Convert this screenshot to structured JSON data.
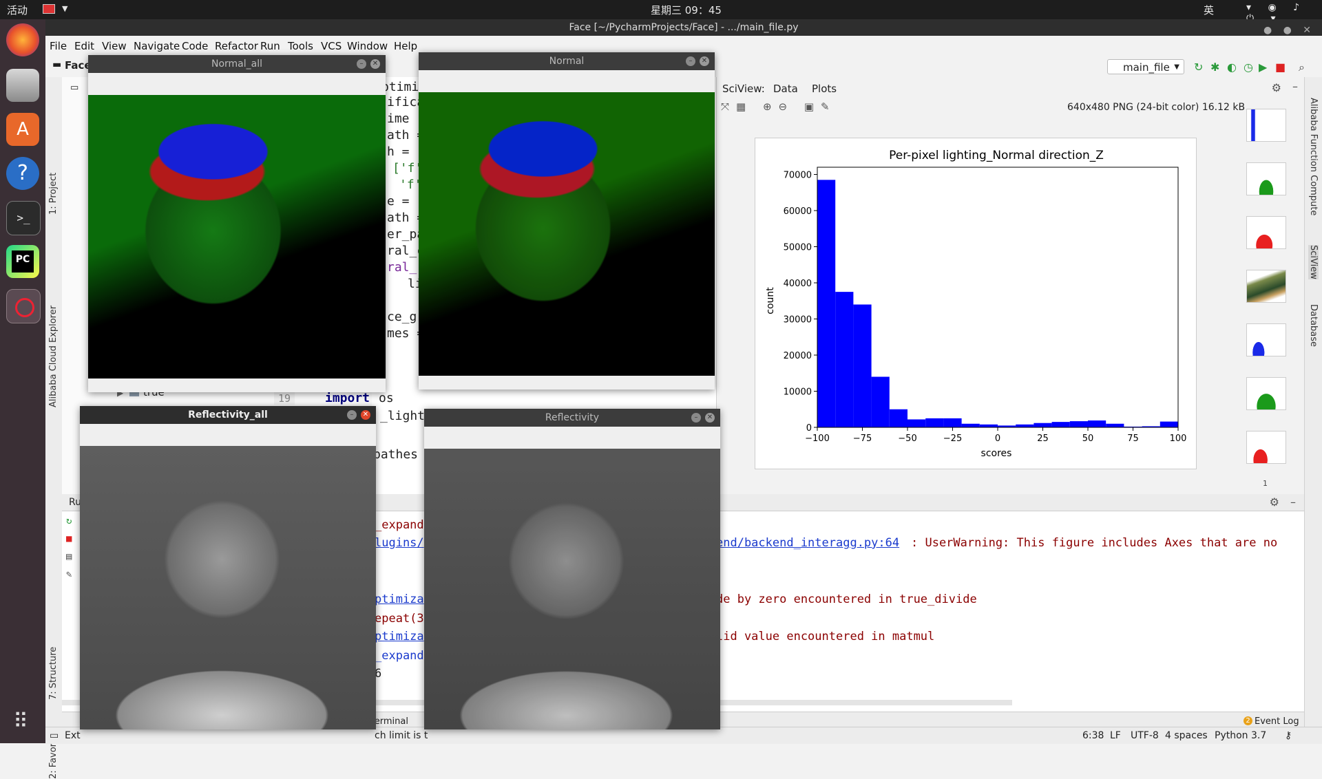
{
  "topbar": {
    "activities": "活动",
    "clock": "星期三 09：45",
    "ime": "英"
  },
  "window": {
    "title": "Face [~/PycharmProjects/Face] - .../main_file.py"
  },
  "menu": [
    "File",
    "Edit",
    "View",
    "Navigate",
    "Code",
    "Refactor",
    "Run",
    "Tools",
    "VCS",
    "Window",
    "Help"
  ],
  "toolbar": {
    "project_name": "Face",
    "run_config": "main_file"
  },
  "side_tools": {
    "project": "1: Project",
    "alibaba_cloud": "Alibaba Cloud Explorer",
    "structure": "7: Structure",
    "favorites": "2: Favorites",
    "alibaba_fc": "Alibaba Function Compute",
    "sciview": "SciView",
    "database": "Database"
  },
  "editor": {
    "lines": [
      "ptimiza",
      "ifica",
      "ime",
      "ath =",
      "h =",
      "['f'",
      "'f'",
      "e =",
      "ath =",
      "er_pa",
      "ral_c",
      "ral_",
      "li",
      "",
      "ce_g",
      "mes =",
      "",
      "os",
      "_light",
      "",
      "pathes"
    ],
    "line_number": "19",
    "tree_item": "true",
    "import_kw": "import"
  },
  "sciview": {
    "tab_title": "SciView:",
    "tab_data": "Data",
    "tab_plots": "Plots",
    "image_info": "640x480 PNG (24-bit color) 16.12 kB",
    "thumb_count": "1"
  },
  "chart_data": {
    "type": "bar",
    "title": "Per-pixel lighting_Normal direction_Z",
    "xlabel": "scores",
    "ylabel": "count",
    "xlim": [
      -100,
      100
    ],
    "ylim": [
      0,
      72000
    ],
    "xticks": [
      -100,
      -75,
      -50,
      -25,
      0,
      25,
      50,
      75,
      100
    ],
    "yticks": [
      0,
      10000,
      20000,
      30000,
      40000,
      50000,
      60000,
      70000
    ],
    "bin_edges": [
      -100,
      -90,
      -80,
      -70,
      -60,
      -50,
      -40,
      -30,
      -20,
      -10,
      0,
      10,
      20,
      30,
      40,
      50,
      60,
      70,
      80,
      90,
      100
    ],
    "values": [
      68500,
      37500,
      34000,
      14000,
      5000,
      2200,
      2500,
      2500,
      1000,
      800,
      500,
      800,
      1200,
      1500,
      1700,
      1900,
      1000,
      200,
      300,
      1600
    ],
    "color": "#0000ff"
  },
  "console": {
    "run_label": "Ru",
    "lines": [
      {
        "text": "_expand",
        "link": false
      },
      {
        "text": "lugins/",
        "link": true
      },
      {
        "text": "end/backend_interagg.py:64",
        "link": true,
        "suffix": ": UserWarning: This figure includes Axes that are no"
      },
      {
        "text": "ptimiza",
        "link": true,
        "mid": "de by zero encountered in true_divide"
      },
      {
        "text": "epeat(3",
        "link": false
      },
      {
        "text": "ptimiza",
        "link": true,
        "mid": "lid value encountered in matmul"
      },
      {
        "text": "_expand",
        "link": true
      },
      {
        "text": "6",
        "link": false
      }
    ]
  },
  "bottom_tabs": {
    "terminal": "Terminal",
    "event_log": "Event Log",
    "event_count": "2"
  },
  "status": {
    "left_text": "Ext",
    "mid_text": "ch limit is t",
    "position": "6:38",
    "line_sep": "LF",
    "encoding": "UTF-8",
    "indent": "4 spaces",
    "interpreter": "Python 3.7"
  },
  "cv_windows": {
    "normal_all": "Normal_all",
    "normal": "Normal",
    "reflectivity_all": "Reflectivity_all",
    "reflectivity": "Reflectivity"
  }
}
